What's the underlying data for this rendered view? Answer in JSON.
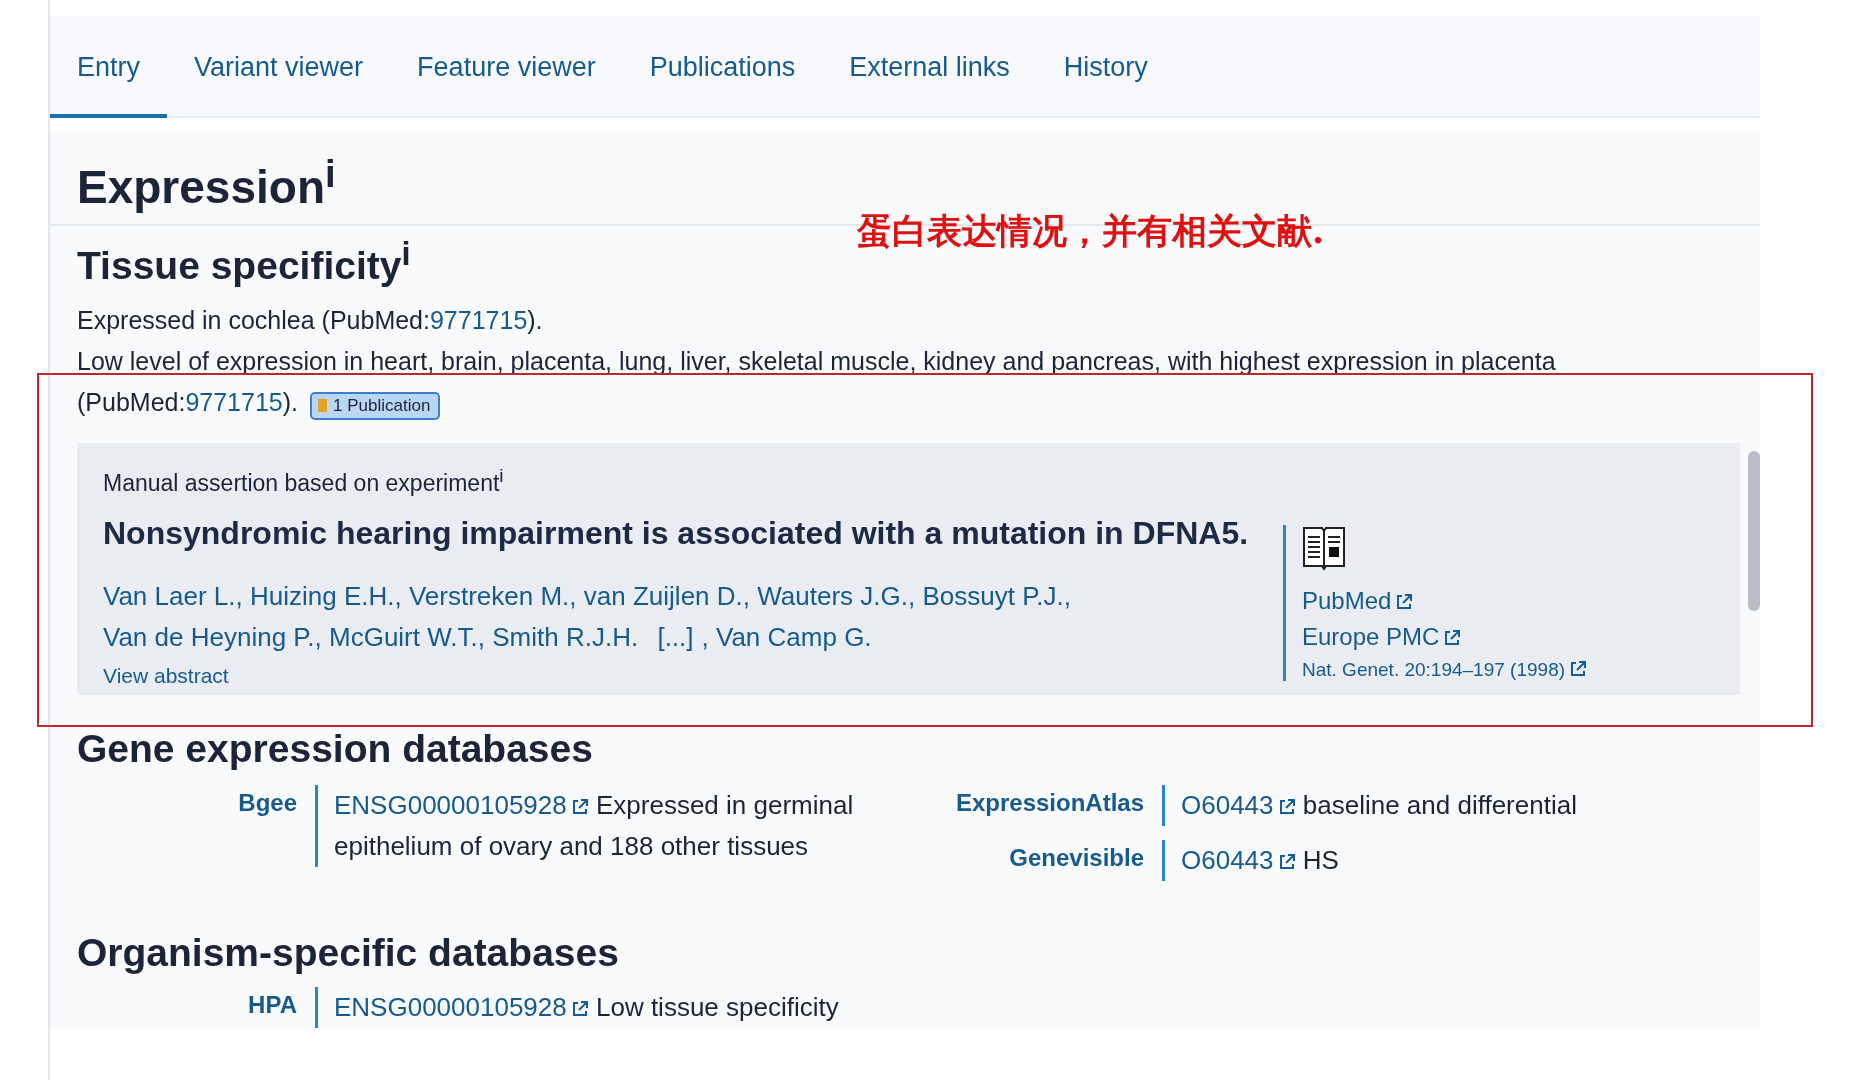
{
  "tabs": [
    {
      "label": "Entry",
      "selected": true
    },
    {
      "label": "Variant viewer",
      "selected": false
    },
    {
      "label": "Feature viewer",
      "selected": false
    },
    {
      "label": "Publications",
      "selected": false
    },
    {
      "label": "External links",
      "selected": false
    },
    {
      "label": "History",
      "selected": false
    }
  ],
  "expression": {
    "title": "Expression$^{i}$",
    "tissue_specificity": {
      "title": "Tissue specificity$^{i}$",
      "paragraphs": [
        {
          "segments": [
            {
              "kind": "text",
              "text": "Expressed in cochlea (PubMed:"
            },
            {
              "kind": "link",
              "text": "9771715"
            },
            {
              "kind": "text",
              "text": ")."
            }
          ]
        },
        {
          "segments": [
            {
              "kind": "text",
              "text": "Low level of expression in heart, brain, placenta, lung, liver, skeletal muscle, kidney and pancreas, with highest expression in placenta (PubMed:"
            },
            {
              "kind": "link",
              "text": "9771715"
            },
            {
              "kind": "text",
              "text": ")."
            }
          ],
          "badge": "1 Publication"
        }
      ]
    },
    "evidence": {
      "heading": "Manual assertion based on experiment$^{i}$",
      "title": "Nonsyndromic hearing impairment is associated with a mutation in DFNA5.",
      "authors": [
        {
          "kind": "author",
          "name": "Van Laer L.",
          "after": ","
        },
        {
          "kind": "author",
          "name": "Huizing E.H.",
          "after": ","
        },
        {
          "kind": "author",
          "name": "Verstreken M.",
          "after": ","
        },
        {
          "kind": "author",
          "name": "van Zuijlen D.",
          "after": ","
        },
        {
          "kind": "author",
          "name": "Wauters J.G.",
          "after": ","
        },
        {
          "kind": "author",
          "name": "Bossuyt P.J.",
          "after": ","
        },
        {
          "kind": "author",
          "name": "Van de Heyning P.",
          "after": ","
        },
        {
          "kind": "author",
          "name": "McGuirt W.T.",
          "after": ","
        },
        {
          "kind": "author",
          "name": "Smith R.J.H."
        },
        {
          "kind": "more",
          "name": "[...]",
          "after": ","
        },
        {
          "kind": "author",
          "name": "Van Camp G."
        }
      ],
      "view_abstract": "View abstract",
      "links": [
        "PubMed",
        "Europe PMC"
      ],
      "citation": "Nat. Genet. 20:194–197 (1998)"
    },
    "gene_expression": {
      "title": "Gene expression databases",
      "columns": [
        [
          {
            "db": "Bgee",
            "id": "ENSG00000105928",
            "description": "Expressed in germinal epithelium of ovary and 188 other tissues"
          }
        ],
        [
          {
            "db": "ExpressionAtlas",
            "id": "O60443",
            "description": "baseline and differential"
          },
          {
            "db": "Genevisible",
            "id": "O60443",
            "description": "HS"
          }
        ]
      ]
    },
    "organism": {
      "title": "Organism-specific databases",
      "rows": [
        {
          "db": "HPA",
          "id": "ENSG00000105928",
          "description": "Low tissue specificity"
        }
      ]
    }
  },
  "annotation": {
    "note": "蛋白表达情况，并有相关文献."
  }
}
